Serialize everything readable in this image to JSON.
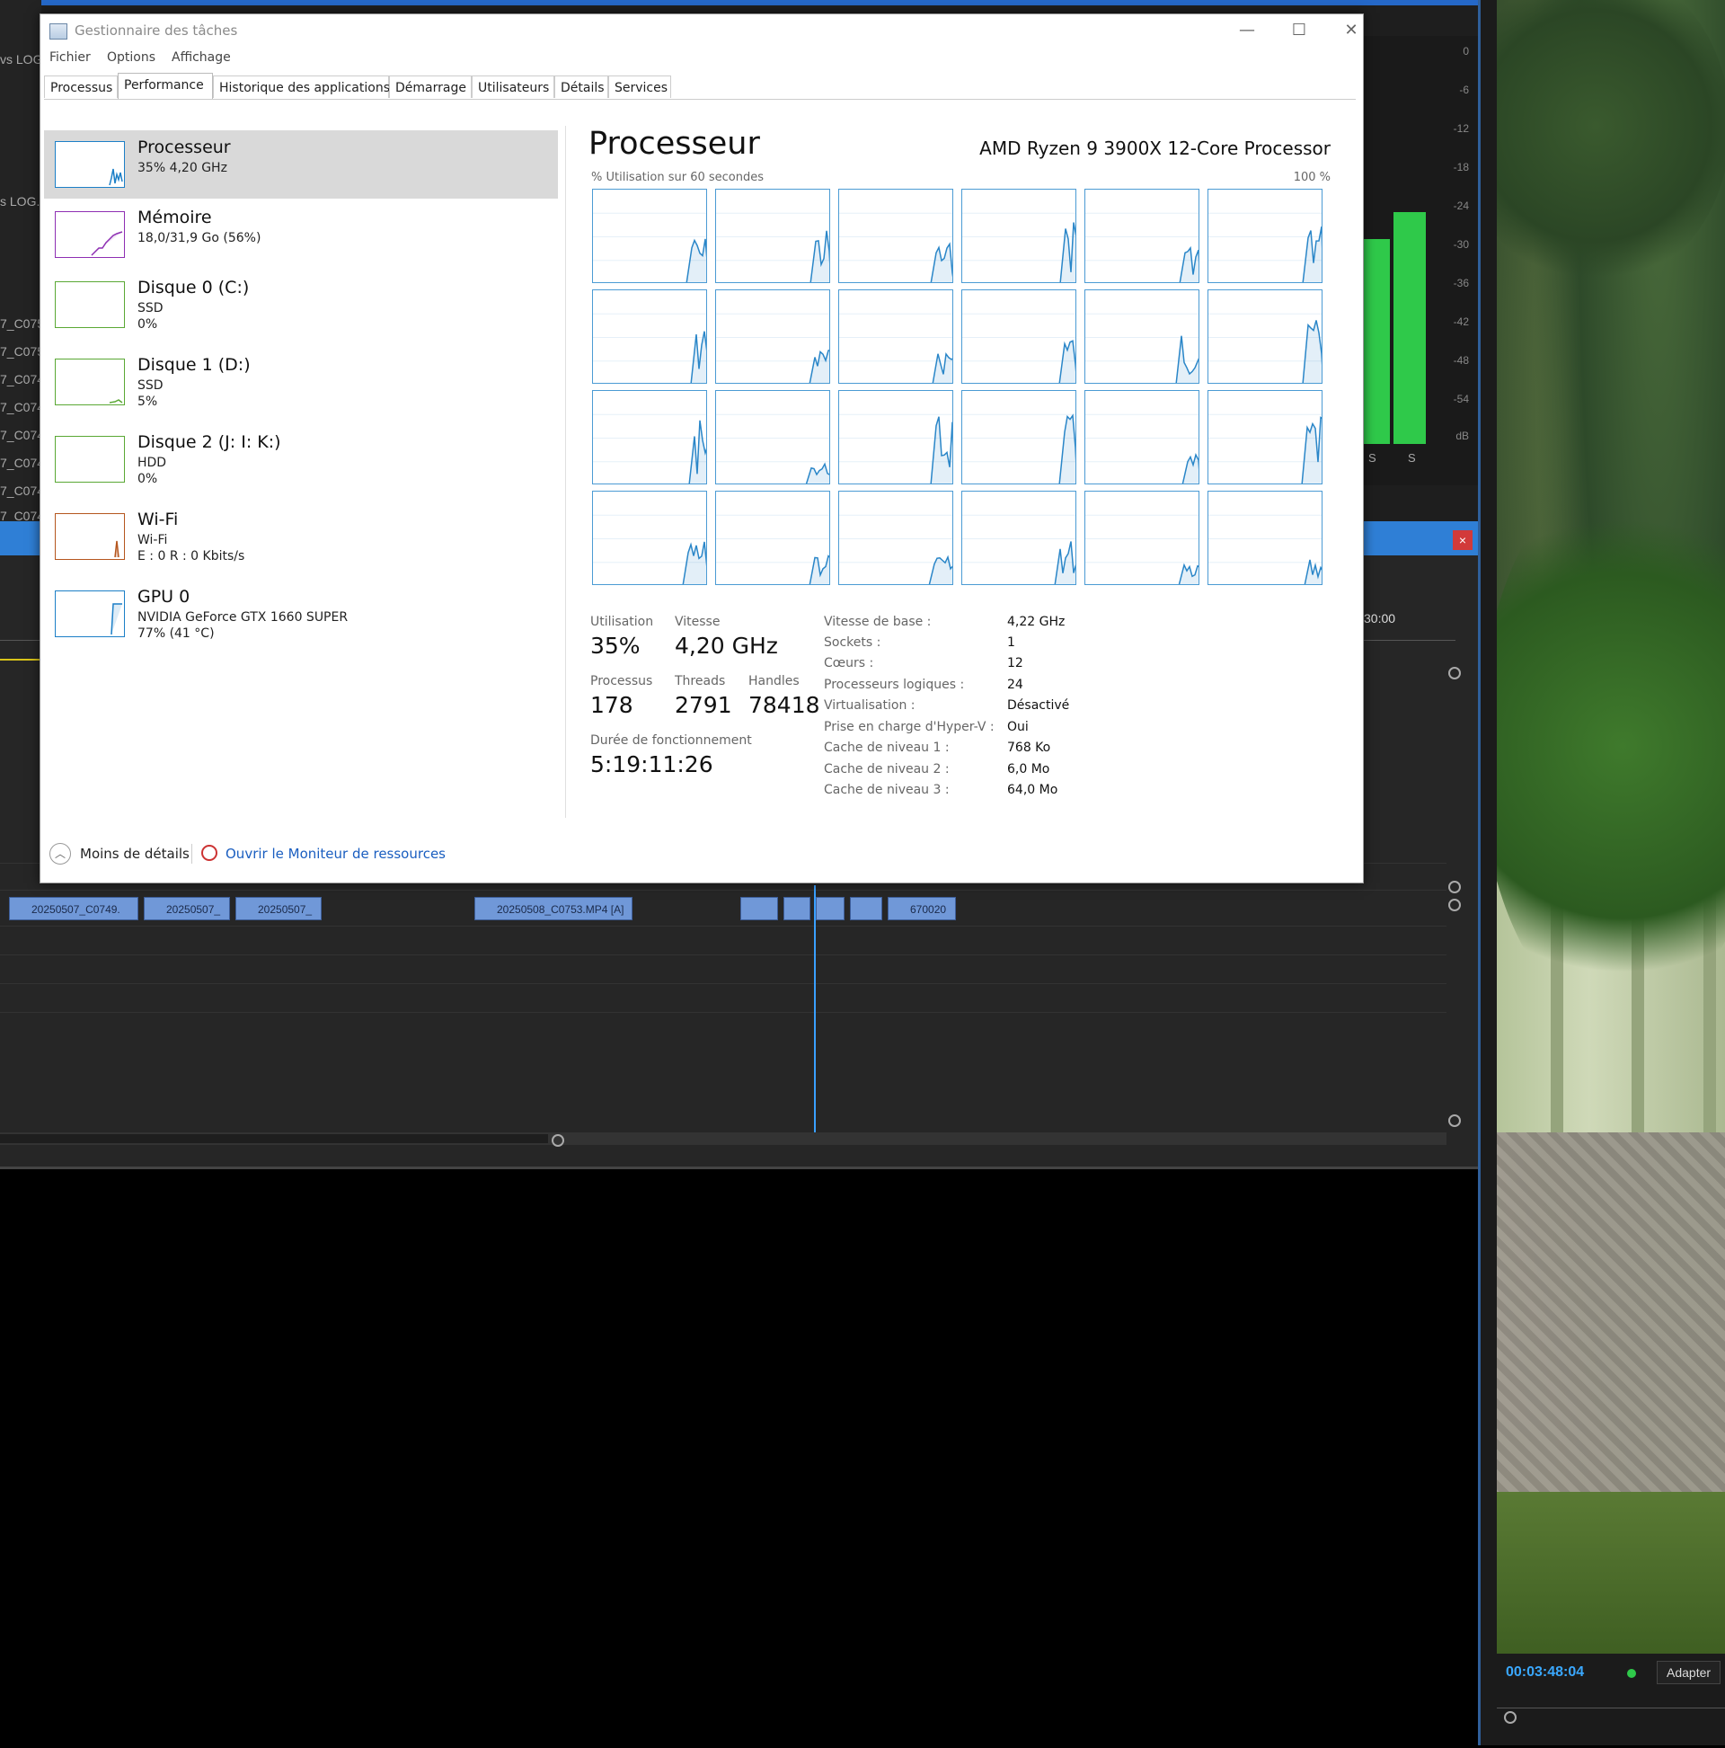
{
  "editor": {
    "left_labels": [
      "vs LOG",
      "s LOG.p",
      "7_C075",
      "7_C075",
      "7_C074",
      "7_C074",
      "7_C074",
      "7_C074",
      "7_C074",
      "7_C074"
    ],
    "meter_db": [
      "0",
      "-6",
      "-12",
      "-18",
      "-24",
      "-30",
      "-36",
      "-42",
      "-48",
      "-54",
      "dB"
    ],
    "meter_solo": [
      "S",
      "S"
    ],
    "close_x": "×",
    "ruler_time": "30:00",
    "clips": [
      "20250507_C0749.",
      "20250507_",
      "20250507_",
      "20250508_C0753.MP4 [A]",
      "670020"
    ]
  },
  "preview": {
    "timecode": "00:03:48:04",
    "fit_label": "Adapter"
  },
  "taskmanager": {
    "title": "Gestionnaire des tâches",
    "window_buttons": {
      "minimize": "—",
      "maximize": "☐",
      "close": "✕"
    },
    "menu": [
      "Fichier",
      "Options",
      "Affichage"
    ],
    "tabs": [
      "Processus",
      "Performance",
      "Historique des applications",
      "Démarrage",
      "Utilisateurs",
      "Détails",
      "Services"
    ],
    "active_tab": "Performance",
    "sidebar": [
      {
        "name": "Processeur",
        "lines": [
          "35% 4,20 GHz"
        ],
        "color": "#1c7fc7",
        "selected": true
      },
      {
        "name": "Mémoire",
        "lines": [
          "18,0/31,9 Go (56%)"
        ],
        "color": "#8e2fb3",
        "selected": false
      },
      {
        "name": "Disque 0 (C:)",
        "lines": [
          "SSD",
          "0%"
        ],
        "color": "#5aa834",
        "selected": false
      },
      {
        "name": "Disque 1 (D:)",
        "lines": [
          "SSD",
          "5%"
        ],
        "color": "#5aa834",
        "selected": false
      },
      {
        "name": "Disque 2 (J: I: K:)",
        "lines": [
          "HDD",
          "0%"
        ],
        "color": "#5aa834",
        "selected": false
      },
      {
        "name": "Wi-Fi",
        "lines": [
          "Wi-Fi",
          "E : 0 R : 0 Kbits/s"
        ],
        "color": "#b5561e",
        "selected": false
      },
      {
        "name": "GPU 0",
        "lines": [
          "NVIDIA GeForce GTX 1660 SUPER",
          "77% (41 °C)"
        ],
        "color": "#1c7fc7",
        "selected": false
      }
    ],
    "main": {
      "title": "Processeur",
      "processor_name": "AMD Ryzen 9 3900X 12-Core Processor",
      "graph_caption": "% Utilisation sur 60 secondes",
      "graph_max": "100 %",
      "stats": {
        "utilisation_label": "Utilisation",
        "utilisation": "35%",
        "vitesse_label": "Vitesse",
        "vitesse": "4,20 GHz",
        "processus_label": "Processus",
        "processus": "178",
        "threads_label": "Threads",
        "threads": "2791",
        "handles_label": "Handles",
        "handles": "78418",
        "uptime_label": "Durée de fonctionnement",
        "uptime": "5:19:11:26"
      },
      "details": [
        {
          "label": "Vitesse de base :",
          "value": "4,22 GHz"
        },
        {
          "label": "Sockets :",
          "value": "1"
        },
        {
          "label": "Cœurs :",
          "value": "12"
        },
        {
          "label": "Processeurs logiques :",
          "value": "24"
        },
        {
          "label": "Virtualisation :",
          "value": "Désactivé"
        },
        {
          "label": "Prise en charge d'Hyper-V :",
          "value": "Oui"
        },
        {
          "label": "Cache de niveau 1 :",
          "value": "768 Ko"
        },
        {
          "label": "Cache de niveau 2 :",
          "value": "6,0 Mo"
        },
        {
          "label": "Cache de niveau 3 :",
          "value": "64,0 Mo"
        }
      ]
    },
    "footer": {
      "less_details": "Moins de détails",
      "resource_monitor": "Ouvrir le Moniteur de ressources"
    }
  }
}
